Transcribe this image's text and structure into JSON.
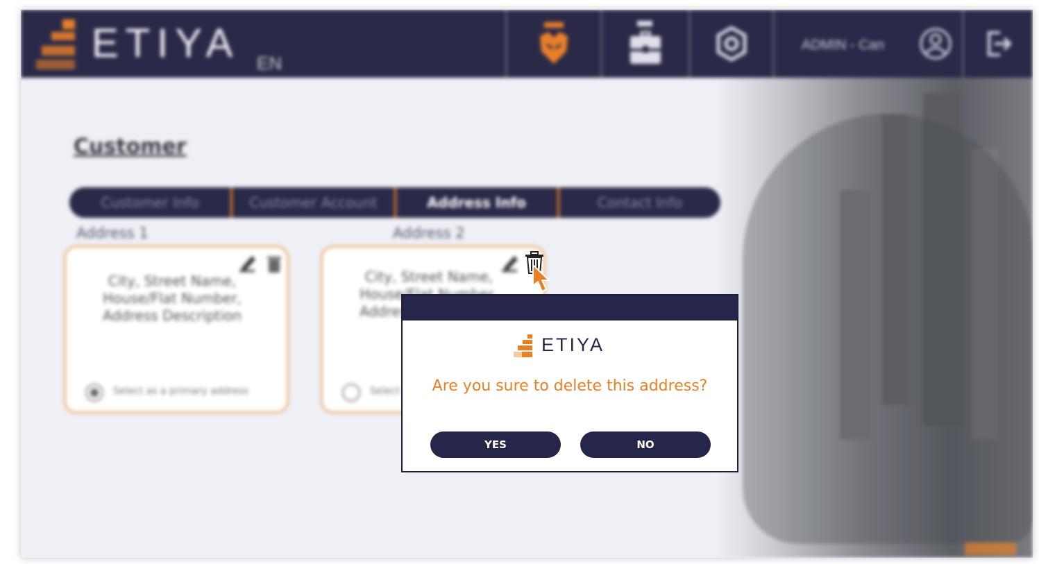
{
  "header": {
    "logo_text": "ETIYA",
    "language": "EN",
    "user": "ADMIN - Can",
    "icons": [
      "fox-icon",
      "briefcase-icon",
      "settings-gear-icon",
      "user-avatar-icon",
      "logout-icon"
    ]
  },
  "page": {
    "title": "Customer",
    "tabs": [
      {
        "label": "Customer Info",
        "active": false
      },
      {
        "label": "Customer Account",
        "active": false
      },
      {
        "label": "Address Info",
        "active": true
      },
      {
        "label": "Contact Info",
        "active": false
      }
    ],
    "addresses": [
      {
        "label": "Address 1",
        "text": "City, Street Name, House/Flat Number, Address Description",
        "radio_label": "Select as a primary address",
        "primary": true
      },
      {
        "label": "Address 2",
        "text": "City, Street Name, House/Flat Number, Address Description",
        "radio_label": "Select as a primary address",
        "primary": false
      }
    ]
  },
  "dialog": {
    "logo_text": "ETIYA",
    "message": "Are you sure to delete this address?",
    "yes_label": "YES",
    "no_label": "NO"
  },
  "colors": {
    "navy": "#26264a",
    "orange": "#ec7f22",
    "card_border": "#f0b07a"
  }
}
